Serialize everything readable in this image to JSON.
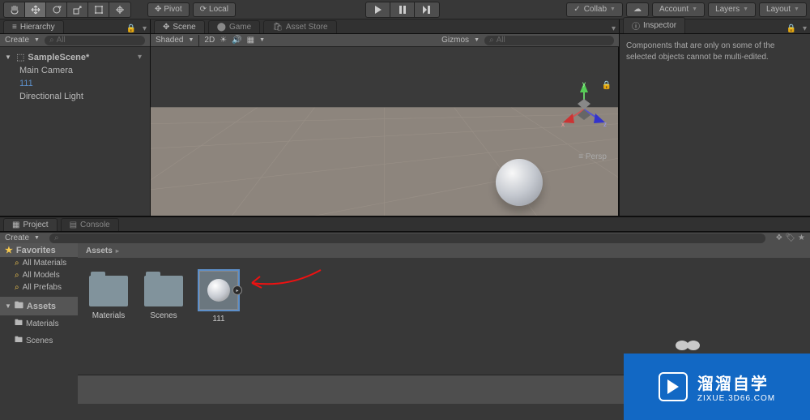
{
  "toolbar": {
    "pivot": "Pivot",
    "local": "Local",
    "collab": "Collab",
    "account": "Account",
    "layers": "Layers",
    "layout": "Layout"
  },
  "hierarchy": {
    "title": "Hierarchy",
    "create": "Create",
    "search_placeholder": "All",
    "scene_name": "SampleScene*",
    "items": [
      "Main Camera",
      "111",
      "Directional Light"
    ]
  },
  "scene": {
    "tabs": [
      "Scene",
      "Game",
      "Asset Store"
    ],
    "shading": "Shaded",
    "mode2d": "2D",
    "gizmos": "Gizmos",
    "search_placeholder": "All",
    "axes": {
      "x": "x",
      "y": "y",
      "z": "z"
    },
    "persp": "Persp"
  },
  "inspector": {
    "title": "Inspector",
    "message": "Components that are only on some of the selected objects cannot be multi-edited."
  },
  "project": {
    "tab_project": "Project",
    "tab_console": "Console",
    "create": "Create",
    "favorites_header": "Favorites",
    "favorites": [
      "All Materials",
      "All Models",
      "All Prefabs"
    ],
    "assets_header": "Assets",
    "asset_folders": [
      "Materials",
      "Scenes"
    ],
    "breadcrumb": "Assets",
    "grid_items": [
      {
        "name": "Materials",
        "kind": "folder"
      },
      {
        "name": "Scenes",
        "kind": "folder"
      },
      {
        "name": "111",
        "kind": "prefab",
        "selected": true
      }
    ]
  },
  "watermark": {
    "main": "溜溜自学",
    "sub": "ZIXUE.3D66.COM"
  }
}
